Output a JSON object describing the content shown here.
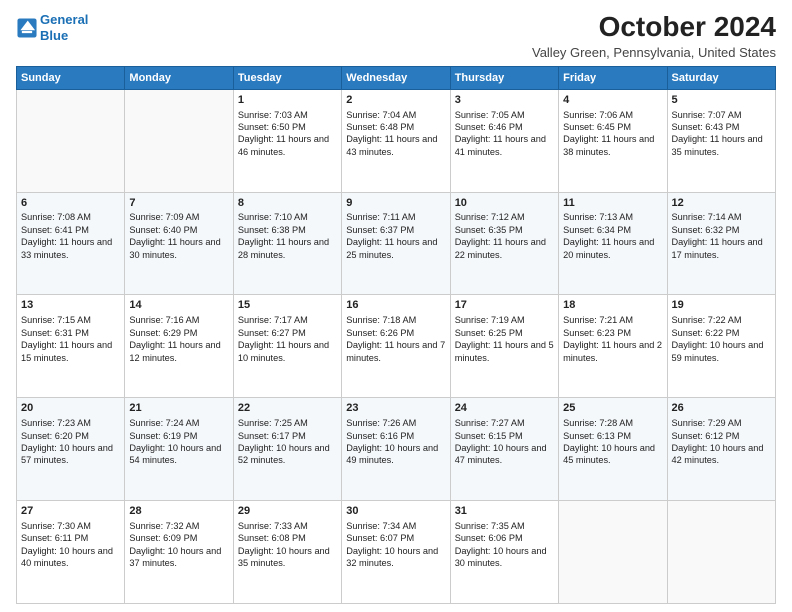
{
  "header": {
    "logo_line1": "General",
    "logo_line2": "Blue",
    "month_year": "October 2024",
    "location": "Valley Green, Pennsylvania, United States"
  },
  "days_of_week": [
    "Sunday",
    "Monday",
    "Tuesday",
    "Wednesday",
    "Thursday",
    "Friday",
    "Saturday"
  ],
  "weeks": [
    [
      {
        "day": "",
        "info": ""
      },
      {
        "day": "",
        "info": ""
      },
      {
        "day": "1",
        "info": "Sunrise: 7:03 AM\nSunset: 6:50 PM\nDaylight: 11 hours and 46 minutes."
      },
      {
        "day": "2",
        "info": "Sunrise: 7:04 AM\nSunset: 6:48 PM\nDaylight: 11 hours and 43 minutes."
      },
      {
        "day": "3",
        "info": "Sunrise: 7:05 AM\nSunset: 6:46 PM\nDaylight: 11 hours and 41 minutes."
      },
      {
        "day": "4",
        "info": "Sunrise: 7:06 AM\nSunset: 6:45 PM\nDaylight: 11 hours and 38 minutes."
      },
      {
        "day": "5",
        "info": "Sunrise: 7:07 AM\nSunset: 6:43 PM\nDaylight: 11 hours and 35 minutes."
      }
    ],
    [
      {
        "day": "6",
        "info": "Sunrise: 7:08 AM\nSunset: 6:41 PM\nDaylight: 11 hours and 33 minutes."
      },
      {
        "day": "7",
        "info": "Sunrise: 7:09 AM\nSunset: 6:40 PM\nDaylight: 11 hours and 30 minutes."
      },
      {
        "day": "8",
        "info": "Sunrise: 7:10 AM\nSunset: 6:38 PM\nDaylight: 11 hours and 28 minutes."
      },
      {
        "day": "9",
        "info": "Sunrise: 7:11 AM\nSunset: 6:37 PM\nDaylight: 11 hours and 25 minutes."
      },
      {
        "day": "10",
        "info": "Sunrise: 7:12 AM\nSunset: 6:35 PM\nDaylight: 11 hours and 22 minutes."
      },
      {
        "day": "11",
        "info": "Sunrise: 7:13 AM\nSunset: 6:34 PM\nDaylight: 11 hours and 20 minutes."
      },
      {
        "day": "12",
        "info": "Sunrise: 7:14 AM\nSunset: 6:32 PM\nDaylight: 11 hours and 17 minutes."
      }
    ],
    [
      {
        "day": "13",
        "info": "Sunrise: 7:15 AM\nSunset: 6:31 PM\nDaylight: 11 hours and 15 minutes."
      },
      {
        "day": "14",
        "info": "Sunrise: 7:16 AM\nSunset: 6:29 PM\nDaylight: 11 hours and 12 minutes."
      },
      {
        "day": "15",
        "info": "Sunrise: 7:17 AM\nSunset: 6:27 PM\nDaylight: 11 hours and 10 minutes."
      },
      {
        "day": "16",
        "info": "Sunrise: 7:18 AM\nSunset: 6:26 PM\nDaylight: 11 hours and 7 minutes."
      },
      {
        "day": "17",
        "info": "Sunrise: 7:19 AM\nSunset: 6:25 PM\nDaylight: 11 hours and 5 minutes."
      },
      {
        "day": "18",
        "info": "Sunrise: 7:21 AM\nSunset: 6:23 PM\nDaylight: 11 hours and 2 minutes."
      },
      {
        "day": "19",
        "info": "Sunrise: 7:22 AM\nSunset: 6:22 PM\nDaylight: 10 hours and 59 minutes."
      }
    ],
    [
      {
        "day": "20",
        "info": "Sunrise: 7:23 AM\nSunset: 6:20 PM\nDaylight: 10 hours and 57 minutes."
      },
      {
        "day": "21",
        "info": "Sunrise: 7:24 AM\nSunset: 6:19 PM\nDaylight: 10 hours and 54 minutes."
      },
      {
        "day": "22",
        "info": "Sunrise: 7:25 AM\nSunset: 6:17 PM\nDaylight: 10 hours and 52 minutes."
      },
      {
        "day": "23",
        "info": "Sunrise: 7:26 AM\nSunset: 6:16 PM\nDaylight: 10 hours and 49 minutes."
      },
      {
        "day": "24",
        "info": "Sunrise: 7:27 AM\nSunset: 6:15 PM\nDaylight: 10 hours and 47 minutes."
      },
      {
        "day": "25",
        "info": "Sunrise: 7:28 AM\nSunset: 6:13 PM\nDaylight: 10 hours and 45 minutes."
      },
      {
        "day": "26",
        "info": "Sunrise: 7:29 AM\nSunset: 6:12 PM\nDaylight: 10 hours and 42 minutes."
      }
    ],
    [
      {
        "day": "27",
        "info": "Sunrise: 7:30 AM\nSunset: 6:11 PM\nDaylight: 10 hours and 40 minutes."
      },
      {
        "day": "28",
        "info": "Sunrise: 7:32 AM\nSunset: 6:09 PM\nDaylight: 10 hours and 37 minutes."
      },
      {
        "day": "29",
        "info": "Sunrise: 7:33 AM\nSunset: 6:08 PM\nDaylight: 10 hours and 35 minutes."
      },
      {
        "day": "30",
        "info": "Sunrise: 7:34 AM\nSunset: 6:07 PM\nDaylight: 10 hours and 32 minutes."
      },
      {
        "day": "31",
        "info": "Sunrise: 7:35 AM\nSunset: 6:06 PM\nDaylight: 10 hours and 30 minutes."
      },
      {
        "day": "",
        "info": ""
      },
      {
        "day": "",
        "info": ""
      }
    ]
  ]
}
